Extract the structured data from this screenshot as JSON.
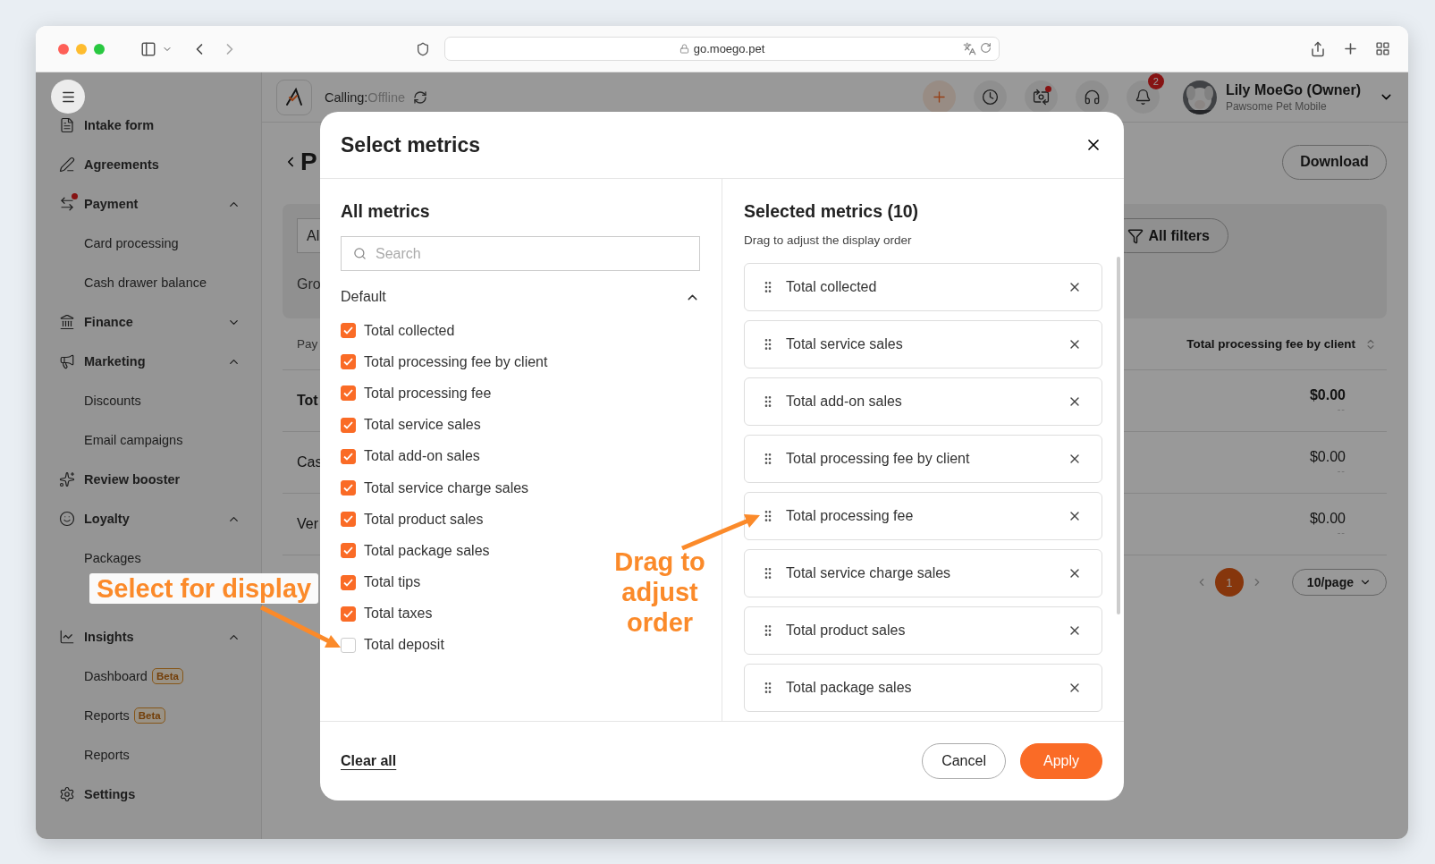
{
  "browser": {
    "url": "go.moego.pet"
  },
  "sidebar": {
    "items": [
      {
        "kind": "link",
        "label": "Intake form",
        "notification": false
      },
      {
        "kind": "link",
        "label": "Agreements",
        "notification": false
      },
      {
        "kind": "group",
        "label": "Payment",
        "notification": true,
        "expanded": true,
        "children": [
          {
            "label": "Card processing"
          },
          {
            "label": "Cash drawer balance"
          }
        ]
      },
      {
        "kind": "group",
        "label": "Finance",
        "notification": false,
        "expanded": false
      },
      {
        "kind": "group",
        "label": "Marketing",
        "notification": false,
        "expanded": true,
        "children": [
          {
            "label": "Discounts"
          },
          {
            "label": "Email campaigns"
          }
        ]
      },
      {
        "kind": "link",
        "label": "Review booster",
        "notification": false
      },
      {
        "kind": "group",
        "label": "Loyalty",
        "notification": false,
        "expanded": true,
        "children": [
          {
            "label": "Packages"
          }
        ]
      },
      {
        "kind": "group",
        "label": "Insights",
        "notification": false,
        "expanded": true,
        "children": [
          {
            "label": "Dashboard",
            "badge": "Beta"
          },
          {
            "label": "Reports",
            "badge": "Beta"
          },
          {
            "label": "Reports"
          }
        ]
      },
      {
        "kind": "link",
        "label": "Settings",
        "notification": false
      }
    ]
  },
  "header": {
    "calling_label": "Calling:",
    "calling_status": "Offline",
    "actions": [
      {
        "kind": "add",
        "alert": false
      },
      {
        "kind": "clock",
        "alert": false
      },
      {
        "kind": "camera",
        "alert": true
      },
      {
        "kind": "support",
        "alert": false
      },
      {
        "kind": "notifications",
        "alert": false,
        "badge": "2"
      }
    ],
    "user": {
      "name": "Lily MoeGo (Owner)",
      "business": "Pawsome Pet Mobile"
    }
  },
  "page": {
    "title": "P",
    "download": "Download",
    "filter_field": "Al",
    "all_filters": "All filters",
    "group_label": "Gro",
    "table": {
      "columns": [
        "Pay",
        "Total processing fee by client"
      ],
      "rows": [
        {
          "label": "Tot",
          "value": "$0.00",
          "sub": "--",
          "bold": true
        },
        {
          "label": "Cas",
          "value": "$0.00",
          "sub": "--",
          "bold": false
        },
        {
          "label": "Ver",
          "value": "$0.00",
          "sub": "--",
          "bold": false
        }
      ]
    },
    "pagination": {
      "pages": [
        {
          "label": "1",
          "selected": true
        }
      ],
      "page_size": "10/page"
    }
  },
  "dialog": {
    "title": "Select metrics",
    "all_title": "All metrics",
    "search_placeholder": "Search",
    "group": {
      "label": "Default",
      "expanded": true,
      "metrics": [
        {
          "label": "Total collected",
          "checked": true
        },
        {
          "label": "Total processing fee by client",
          "checked": true
        },
        {
          "label": "Total processing fee",
          "checked": true
        },
        {
          "label": "Total service sales",
          "checked": true
        },
        {
          "label": "Total add-on sales",
          "checked": true
        },
        {
          "label": "Total service charge sales",
          "checked": true
        },
        {
          "label": "Total product sales",
          "checked": true
        },
        {
          "label": "Total package sales",
          "checked": true
        },
        {
          "label": "Total tips",
          "checked": true
        },
        {
          "label": "Total taxes",
          "checked": true
        },
        {
          "label": "Total deposit",
          "checked": false
        }
      ]
    },
    "selected_title": "Selected metrics (10)",
    "selected_hint": "Drag to adjust the display order",
    "selected": [
      "Total collected",
      "Total service sales",
      "Total add-on sales",
      "Total processing fee by client",
      "Total processing fee",
      "Total service charge sales",
      "Total product sales",
      "Total package sales"
    ],
    "clear_all": "Clear all",
    "cancel": "Cancel",
    "apply": "Apply"
  },
  "annotations": [
    {
      "kind": "select",
      "text": "Select for display"
    },
    {
      "kind": "drag",
      "text": "Drag to adjust order"
    }
  ]
}
